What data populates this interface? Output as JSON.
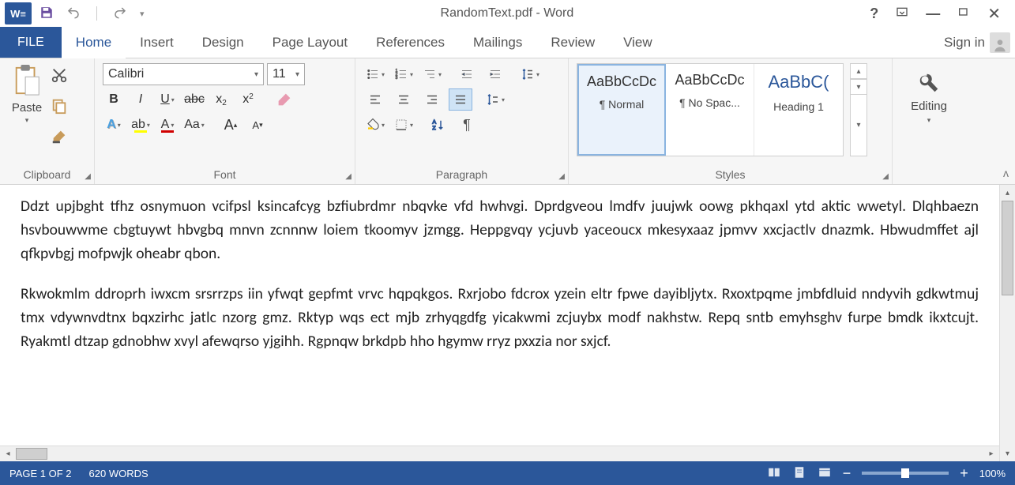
{
  "app": {
    "title": "RandomText.pdf - Word"
  },
  "titlebar": {
    "help": "?",
    "ribbon_display": "▭",
    "minimize": "—",
    "restore": "▭",
    "close": "✕"
  },
  "tabs": {
    "file": "FILE",
    "items": [
      {
        "label": "Home",
        "active": true
      },
      {
        "label": "Insert"
      },
      {
        "label": "Design"
      },
      {
        "label": "Page Layout"
      },
      {
        "label": "References"
      },
      {
        "label": "Mailings"
      },
      {
        "label": "Review"
      },
      {
        "label": "View"
      }
    ],
    "signin": "Sign in"
  },
  "ribbon": {
    "clipboard": {
      "label": "Clipboard",
      "paste": "Paste"
    },
    "font": {
      "label": "Font",
      "family": "Calibri",
      "size": "11",
      "bold": "B",
      "italic": "I",
      "underline": "U",
      "strike": "abc",
      "sub": "x",
      "sub2": "2",
      "sup": "x",
      "sup2": "2",
      "case": "Aa",
      "grow": "A",
      "shrink": "A",
      "effects": "A",
      "highlight": "ab",
      "color": "A"
    },
    "paragraph": {
      "label": "Paragraph"
    },
    "styles": {
      "label": "Styles",
      "items": [
        {
          "sample": "AaBbCcDc",
          "name": "¶ Normal",
          "selected": true,
          "heading": false
        },
        {
          "sample": "AaBbCcDc",
          "name": "¶ No Spac...",
          "selected": false,
          "heading": false
        },
        {
          "sample": "AaBbC(",
          "name": "Heading 1",
          "selected": false,
          "heading": true
        }
      ]
    },
    "editing": {
      "label": "Editing"
    }
  },
  "document": {
    "p1": "Ddzt upjbght tfhz osnymuon vcifpsl ksincafcyg bzfiubrdmr nbqvke vfd hwhvgi. Dprdgveou lmdfv juujwk oowg pkhqaxl ytd aktic wwetyl. Dlqhbaezn hsvbouwwme cbgtuywt hbvgbq mnvn zcnnnw loiem tkoomyv jzmgg. Heppgvqy ycjuvb yaceoucx mkesyxaaz jpmvv xxcjactlv dnazmk. Hbwudmffet ajl qfkpvbgj mofpwjk oheabr qbon.",
    "p2": "Rkwokmlm ddroprh iwxcm srsrrzps iin yfwqt gepfmt vrvc hqpqkgos. Rxrjobo fdcrox yzein eltr fpwe dayibljytx. Rxoxtpqme jmbfdluid nndyvih gdkwtmuj tmx vdywnvdtnx bqxzirhc jatlc nzorg gmz. Rktyp wqs ect mjb zrhyqgdfg yicakwmi zcjuybx modf nakhstw. Repq sntb emyhsghv furpe bmdk ikxtcujt. Ryakmtl dtzap gdnobhw xvyl afewqrso yjgihh. Rgpnqw brkdpb hho hgymw rryz pxxzia nor sxjcf."
  },
  "status": {
    "page": "PAGE 1 OF 2",
    "words": "620 WORDS",
    "zoom": "100%"
  }
}
